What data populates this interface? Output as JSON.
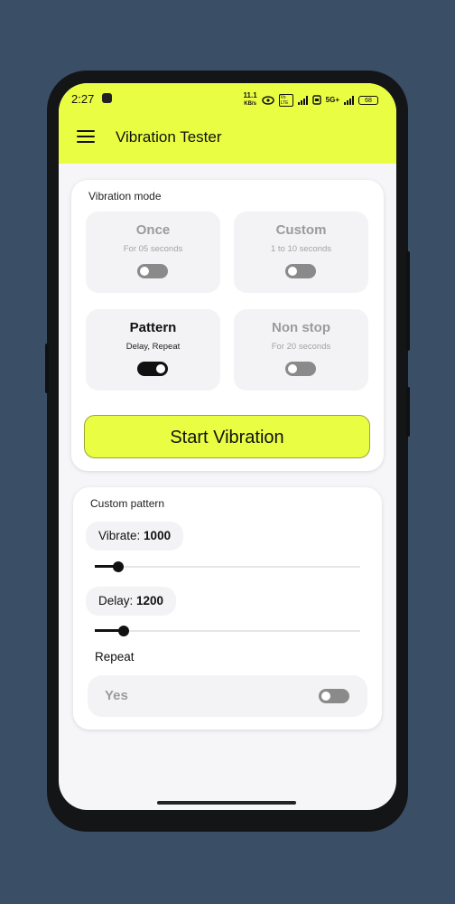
{
  "status_bar": {
    "time": "2:27",
    "net_speed_value": "11.1",
    "net_speed_unit": "KB/s",
    "volte": "Vo LTE",
    "network": "5G+",
    "battery": "68"
  },
  "header": {
    "title": "Vibration Tester"
  },
  "vibration_mode": {
    "label": "Vibration mode",
    "modes": [
      {
        "title": "Once",
        "subtitle": "For 05 seconds",
        "enabled": false
      },
      {
        "title": "Custom",
        "subtitle": "1 to 10 seconds",
        "enabled": false
      },
      {
        "title": "Pattern",
        "subtitle": "Delay, Repeat",
        "enabled": true
      },
      {
        "title": "Non stop",
        "subtitle": "For 20 seconds",
        "enabled": false
      }
    ],
    "start_button": "Start Vibration"
  },
  "custom_pattern": {
    "label": "Custom pattern",
    "vibrate_label": "Vibrate:",
    "vibrate_value": "1000",
    "vibrate_fraction": 0.09,
    "delay_label": "Delay:",
    "delay_value": "1200",
    "delay_fraction": 0.11,
    "repeat_label": "Repeat",
    "repeat_option": "Yes",
    "repeat_enabled": false
  },
  "colors": {
    "accent": "#e9fd43",
    "background": "#3a4e66",
    "toggle_on": "#111111",
    "toggle_off": "#8a8a8a"
  }
}
